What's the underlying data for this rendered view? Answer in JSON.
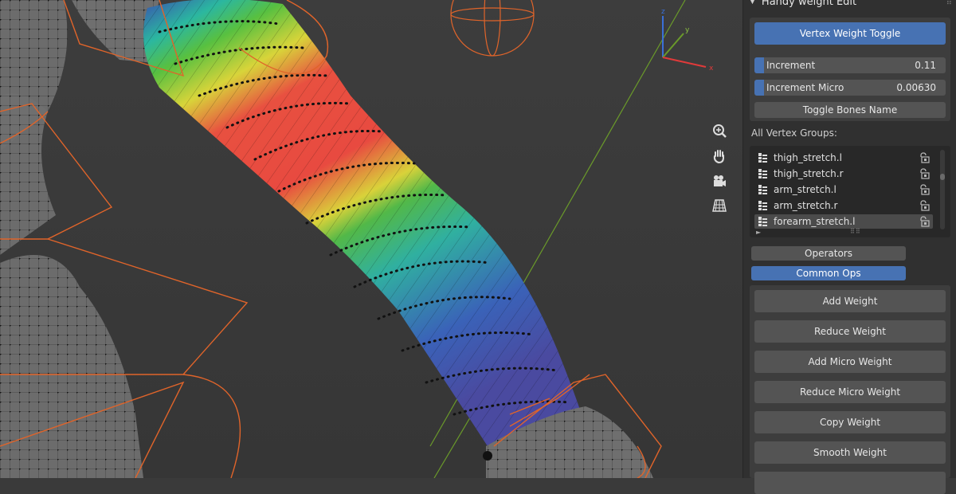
{
  "panel": {
    "title": "Handy weight Edit",
    "vertex_weight_toggle": "Vertex Weight Toggle",
    "increment": {
      "label": "Increment",
      "value": "0.11",
      "fill_fraction": 0.05
    },
    "increment_micro": {
      "label": "Increment Micro",
      "value": "0.00630",
      "fill_fraction": 0.05
    },
    "toggle_bones_name": "Toggle Bones Name",
    "vertex_groups_label": "All Vertex Groups:",
    "vertex_groups": [
      {
        "name": "thigh_stretch.l",
        "active": false
      },
      {
        "name": "thigh_stretch.r",
        "active": false
      },
      {
        "name": "arm_stretch.l",
        "active": false
      },
      {
        "name": "arm_stretch.r",
        "active": false
      },
      {
        "name": "forearm_stretch.l",
        "active": true
      }
    ],
    "tabs": [
      {
        "label": "Operators",
        "active": false
      },
      {
        "label": "Common Ops",
        "active": true
      }
    ],
    "ops": [
      "Add Weight",
      "Reduce Weight",
      "Add Micro Weight",
      "Reduce Micro Weight",
      "Copy Weight",
      "Smooth Weight"
    ]
  },
  "viewport": {
    "gizmo_axes": {
      "x": "x",
      "y": "y",
      "z": "z"
    },
    "tools": [
      "zoom-icon",
      "hand-pan-icon",
      "camera-icon",
      "grid-view-icon"
    ]
  },
  "colors": {
    "accent_blue": "#4772b3",
    "wire_orange": "#e0642a",
    "axis_green": "#6a9a2a"
  }
}
